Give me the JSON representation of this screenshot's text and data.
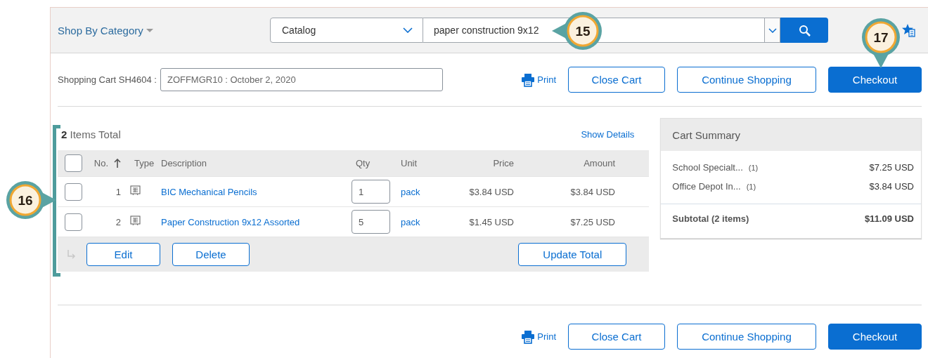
{
  "header": {
    "category_menu": "Shop By Category",
    "search": {
      "scope": "Catalog",
      "query": "paper construction 9x12"
    }
  },
  "cart_bar": {
    "label": "Shopping Cart SH4604 :",
    "name_value": "ZOFFMGR10 : October 2, 2020",
    "actions": [
      {
        "kind": "link",
        "label": "Print"
      },
      {
        "kind": "secondary",
        "label": "Close Cart"
      },
      {
        "kind": "secondary",
        "label": "Continue Shopping"
      },
      {
        "kind": "primary",
        "label": "Checkout"
      }
    ]
  },
  "items": {
    "title": "**2** Items Total",
    "show_details": "Show Details",
    "select_all": {
      "checked": false
    },
    "columns": [
      "No.",
      "Type",
      "Description",
      "Qty",
      "Unit",
      "Price",
      "Amount"
    ],
    "rows": [
      {
        "checked": false,
        "no": "1",
        "description": "BIC Mechanical Pencils",
        "qty": "1",
        "unit": "pack",
        "price": "$3.84 USD",
        "amount": "$3.84 USD"
      },
      {
        "checked": false,
        "no": "2",
        "description": "Paper Construction 9x12 Assorted",
        "qty": "5",
        "unit": "pack",
        "price": "$1.45 USD",
        "amount": "$7.25 USD"
      }
    ],
    "buttons": [
      "Edit",
      "Delete",
      "Update Total"
    ]
  },
  "cart_summary": {
    "title": "Cart Summary",
    "suppliers": [
      {
        "name": "School Specialt...",
        "count": "(1)",
        "amount": "$7.25 USD"
      },
      {
        "name": "Office Depot In...",
        "count": "(1)",
        "amount": "$3.84 USD"
      }
    ],
    "subtotal_label": "Subtotal (2 items)",
    "subtotal": "$11.09 USD"
  },
  "footer_actions": [
    {
      "kind": "link",
      "label": "Print"
    },
    {
      "kind": "secondary",
      "label": "Close Cart"
    },
    {
      "kind": "secondary",
      "label": "Continue Shopping"
    },
    {
      "kind": "primary",
      "label": "Checkout"
    }
  ],
  "callouts": [
    {
      "label": "15"
    },
    {
      "label": "16"
    },
    {
      "label": "17"
    }
  ]
}
